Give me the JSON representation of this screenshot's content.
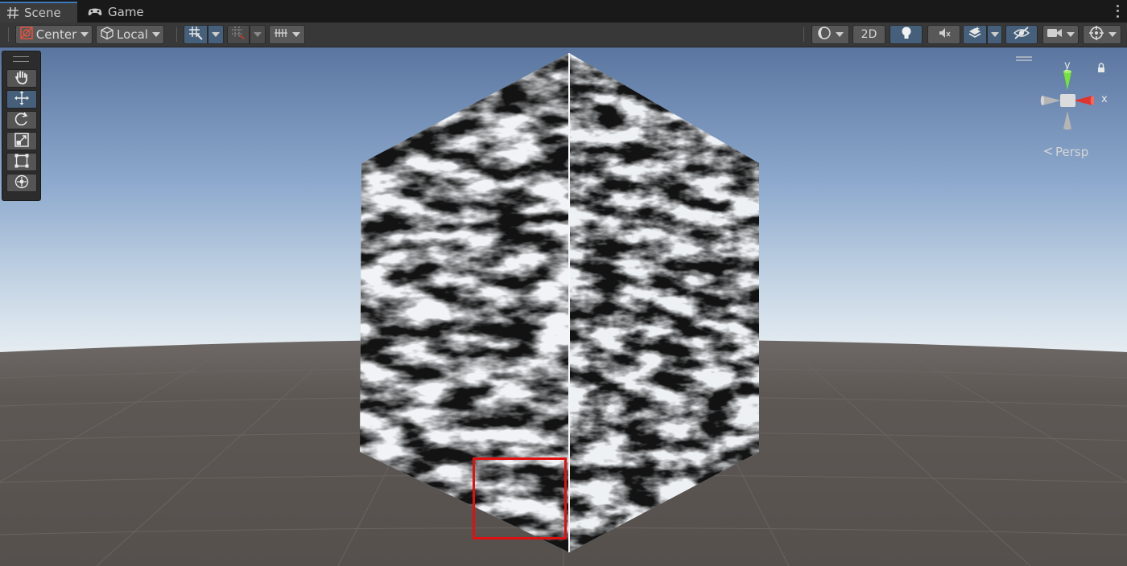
{
  "tabs": [
    {
      "label": "Scene",
      "icon": "hash-icon",
      "active": true
    },
    {
      "label": "Game",
      "icon": "gamepad-icon",
      "active": false
    }
  ],
  "toolbar": {
    "pivot_label": "Center",
    "space_label": "Local",
    "mode_2d_label": "2D"
  },
  "gizmo": {
    "y_label": "y",
    "x_label": "x",
    "projection_label": "Persp"
  },
  "colors": {
    "accent": "#46607c",
    "sky_top": "#5c7aa6",
    "horizon": "#dfe8f0",
    "ground": "#5a5552",
    "highlight": "#e01010",
    "axis_x": "#e23636",
    "axis_y": "#6fe12f"
  }
}
